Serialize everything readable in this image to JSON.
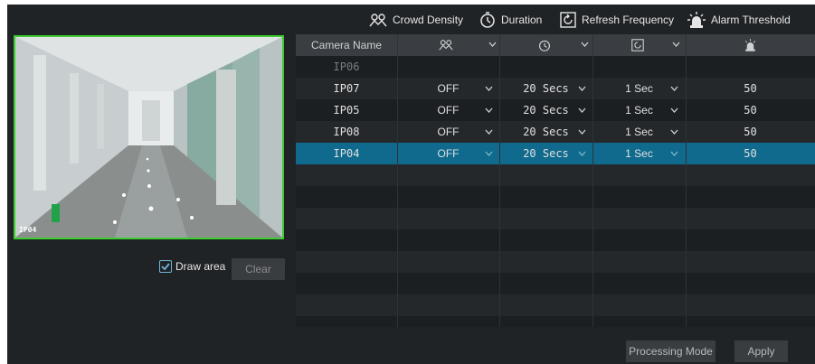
{
  "legend": {
    "crowd_density": "Crowd Density",
    "duration": "Duration",
    "refresh_frequency": "Refresh Frequency",
    "alarm_threshold": "Alarm Threshold"
  },
  "preview": {
    "camera_label": "IP04",
    "border_color": "#3ccd2f"
  },
  "draw_area": {
    "label": "Draw area",
    "checked": true
  },
  "clear_label": "Clear",
  "table": {
    "header": {
      "camera_name": "Camera Name",
      "crowd_icon": "crowd-icon",
      "duration_icon": "timer-icon",
      "refresh_icon": "refresh-icon",
      "alarm_icon": "alarm-icon"
    },
    "rows": [
      {
        "name": "IP06",
        "enabled": "",
        "duration": "",
        "refresh": "",
        "threshold": ""
      },
      {
        "name": "IP07",
        "enabled": "OFF",
        "duration": "20 Secs",
        "refresh": "1 Sec",
        "threshold": "50"
      },
      {
        "name": "IP05",
        "enabled": "OFF",
        "duration": "20 Secs",
        "refresh": "1 Sec",
        "threshold": "50"
      },
      {
        "name": "IP08",
        "enabled": "OFF",
        "duration": "20 Secs",
        "refresh": "1 Sec",
        "threshold": "50"
      },
      {
        "name": "IP04",
        "enabled": "OFF",
        "duration": "20 Secs",
        "refresh": "1 Sec",
        "threshold": "50"
      }
    ],
    "selected_row": 4
  },
  "buttons": {
    "processing_mode": "Processing Mode",
    "apply": "Apply"
  },
  "colors": {
    "selected_row": "#0f6a8d",
    "background": "#202326"
  }
}
